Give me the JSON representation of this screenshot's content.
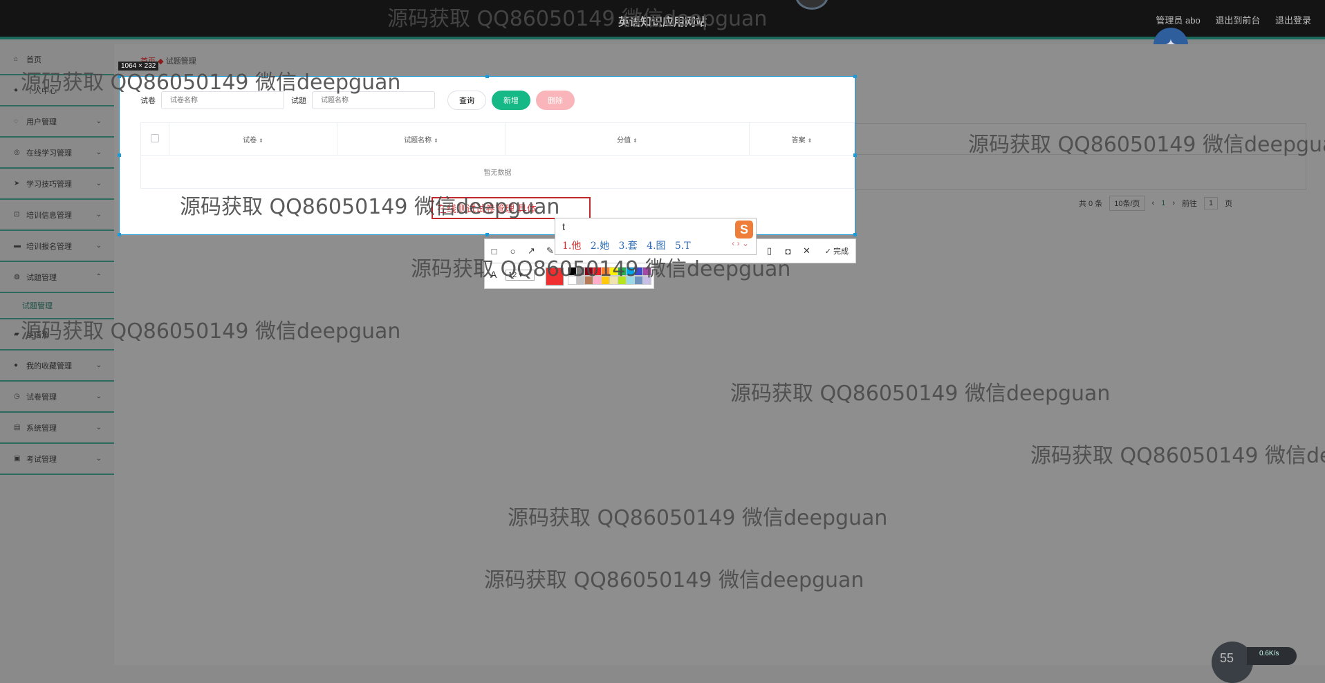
{
  "header": {
    "title": "英语知识应用网站",
    "user": "管理员 abo",
    "to_front": "退出到前台",
    "logout": "退出登录"
  },
  "sidebar": {
    "items": [
      {
        "label": "首页",
        "icon": "home-icon"
      },
      {
        "label": "个人中心",
        "icon": "user-icon"
      },
      {
        "label": "用户管理",
        "icon": "users-icon"
      },
      {
        "label": "在线学习管理",
        "icon": "compass-icon"
      },
      {
        "label": "学习技巧管理",
        "icon": "send-icon"
      },
      {
        "label": "培训信息管理",
        "icon": "crop-icon"
      },
      {
        "label": "培训报名管理",
        "icon": "chat-icon"
      },
      {
        "label": "试题管理",
        "icon": "globe-icon"
      }
    ],
    "sub_item": "试题管理",
    "items_after": [
      {
        "label": "英语角",
        "icon": "folder-icon"
      },
      {
        "label": "我的收藏管理",
        "icon": "star-icon"
      },
      {
        "label": "试卷管理",
        "icon": "clock-icon"
      },
      {
        "label": "系统管理",
        "icon": "doc-icon"
      },
      {
        "label": "考试管理",
        "icon": "exam-icon"
      }
    ]
  },
  "breadcrumb": {
    "home": "首页",
    "current": "试题管理"
  },
  "screenshot": {
    "size_label": "1064 × 232"
  },
  "search": {
    "paper_label": "试卷",
    "paper_placeholder": "试卷名称",
    "question_label": "试题",
    "question_placeholder": "试题名称",
    "query_btn": "查询",
    "add_btn": "新增",
    "delete_btn": "删除"
  },
  "table": {
    "columns": [
      "试卷",
      "试题名称",
      "分值",
      "答案"
    ],
    "empty_text": "暂无数据"
  },
  "pagination": {
    "total": "共 0 条",
    "page_size": "10条/页",
    "current_page": "1",
    "goto_label": "前往",
    "goto_value": "1",
    "page_suffix": "页"
  },
  "annotation": {
    "text": "在线测试试卷管理 具体"
  },
  "ime": {
    "input": "t",
    "candidates": [
      "1.他",
      "2.她",
      "3.套",
      "4.图",
      "5.T"
    ]
  },
  "toolbar": {
    "done": "完成",
    "font_size": "12"
  },
  "colors": {
    "accent": "#16b985",
    "danger": "#f9b5ba",
    "annotation_red": "#c0292c",
    "selection_blue": "#1e9ad6",
    "palette": [
      "#000000",
      "#7f7f7f",
      "#880015",
      "#ed1c24",
      "#ff7f27",
      "#fff200",
      "#22b14c",
      "#00a2e8",
      "#3f48cc",
      "#a349a4",
      "#ffffff",
      "#c3c3c3",
      "#b97a57",
      "#ffaec9",
      "#ffc90e",
      "#efe4b0",
      "#b5e61d",
      "#99d9ea",
      "#7092be",
      "#c8bfe7"
    ]
  },
  "watermark": "源码获取 QQ86050149 微信deepguan",
  "status": {
    "gauge": "55",
    "speed": "0.6K/s"
  }
}
